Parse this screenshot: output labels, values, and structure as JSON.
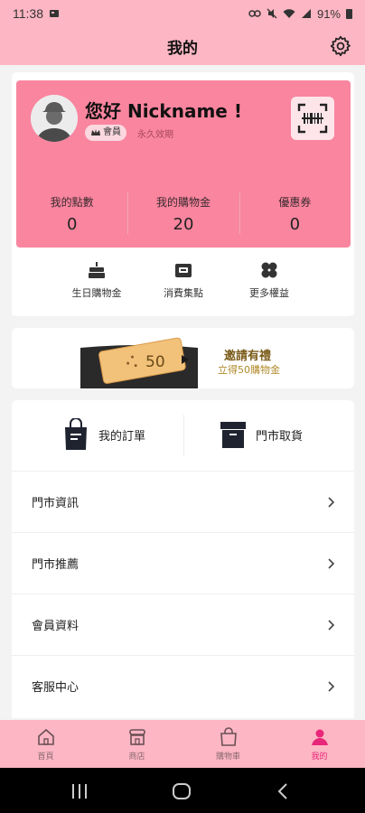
{
  "status_bar": {
    "time": "11:38",
    "battery": "91%"
  },
  "header": {
    "title": "我的"
  },
  "member": {
    "greeting": "您好 Nickname !",
    "badge": "會員",
    "validity": "永久效期",
    "stats": [
      {
        "label": "我的點數",
        "value": "0"
      },
      {
        "label": "我的購物金",
        "value": "20"
      },
      {
        "label": "優惠券",
        "value": "0"
      }
    ]
  },
  "quick_actions": [
    {
      "label": "生日購物金",
      "icon": "cake-icon"
    },
    {
      "label": "消費集點",
      "icon": "stamp-icon"
    },
    {
      "label": "更多權益",
      "icon": "clover-icon"
    }
  ],
  "banner": {
    "title": "邀請有禮",
    "subtitle": "立得50購物金",
    "ticket_value": "50"
  },
  "orders": [
    {
      "label": "我的訂單",
      "icon": "shopping-bag-icon"
    },
    {
      "label": "門市取貨",
      "icon": "box-icon"
    }
  ],
  "menu": [
    {
      "label": "門市資訊"
    },
    {
      "label": "門市推薦"
    },
    {
      "label": "會員資料"
    },
    {
      "label": "客服中心"
    }
  ],
  "tabbar": [
    {
      "label": "首頁",
      "icon": "home-icon"
    },
    {
      "label": "商店",
      "icon": "store-icon"
    },
    {
      "label": "購物車",
      "icon": "cart-bag-icon"
    },
    {
      "label": "我的",
      "icon": "person-icon",
      "active": true
    }
  ],
  "colors": {
    "brand_pink": "#fdb6c3",
    "card_pink": "#fa859f",
    "active_tab": "#e8267a"
  }
}
